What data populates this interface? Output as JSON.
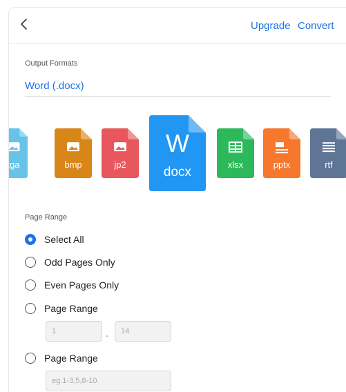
{
  "header": {
    "back_icon": "chevron-left-icon",
    "upgrade_label": "Upgrade",
    "convert_label": "Convert"
  },
  "output": {
    "label": "Output Formats",
    "selected": "Word (.docx)"
  },
  "formats": [
    {
      "ext": "tga",
      "color": "#67c3e8",
      "icon": "image-icon"
    },
    {
      "ext": "bmp",
      "color": "#d98619",
      "icon": "image-icon"
    },
    {
      "ext": "jp2",
      "color": "#e8575d",
      "icon": "image-icon"
    },
    {
      "ext": "docx",
      "color": "#2196f3",
      "icon": "word-icon",
      "glyph": "W"
    },
    {
      "ext": "xlsx",
      "color": "#2eb85c",
      "icon": "spreadsheet-icon"
    },
    {
      "ext": "pptx",
      "color": "#f7772d",
      "icon": "presentation-icon"
    },
    {
      "ext": "rtf",
      "color": "#5f7596",
      "icon": "text-document-icon"
    }
  ],
  "page_range": {
    "label": "Page Range",
    "options": [
      {
        "label": "Select All",
        "checked": true
      },
      {
        "label": "Odd Pages Only",
        "checked": false
      },
      {
        "label": "Even Pages Only",
        "checked": false
      },
      {
        "label": "Page Range",
        "checked": false
      },
      {
        "label": "Page Range",
        "checked": false
      }
    ],
    "from_value": "1",
    "dash": "-",
    "to_value": "14",
    "custom_placeholder": "eg.1-3,5,8-10"
  },
  "colors": {
    "accent": "#1a73e8"
  }
}
